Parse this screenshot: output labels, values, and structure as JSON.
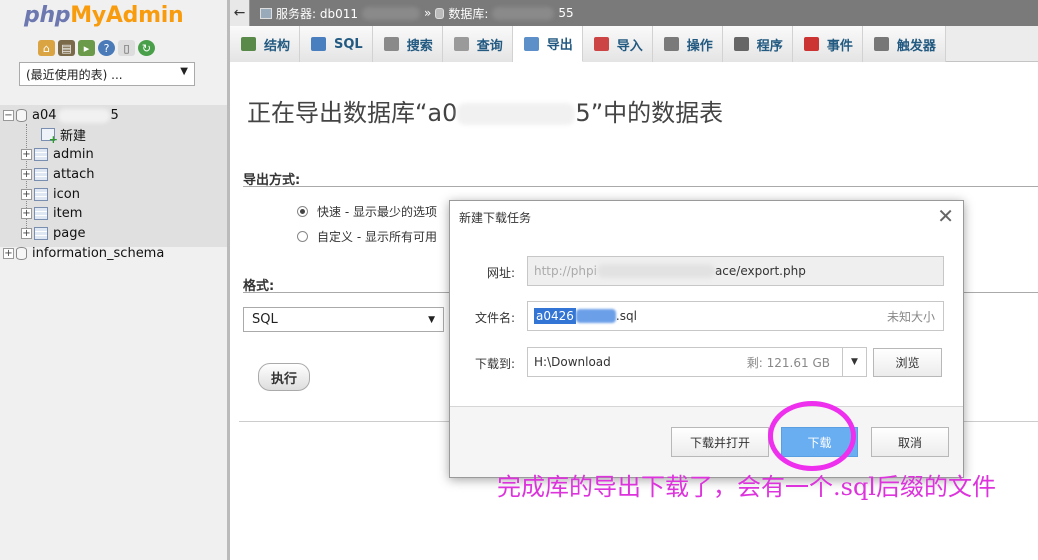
{
  "nav": {
    "logo": {
      "php": "php",
      "my": "My",
      "admin": "Admin"
    },
    "icons": [
      "home-icon",
      "database-icon",
      "sql-icon",
      "help-icon",
      "docs-icon",
      "settings-icon"
    ],
    "recent_tables": "(最近使用的表) ...",
    "tree": {
      "db_name_prefix": "a04",
      "db_name_suffix": "5",
      "new_label": "新建",
      "tables": [
        "admin",
        "attach",
        "icon",
        "item",
        "page"
      ],
      "other_db": "information_schema"
    }
  },
  "topbar": {
    "back": "←",
    "server_label": "服务器: db011",
    "separator": "»",
    "database_label": "数据库:",
    "database_suffix": "55"
  },
  "tabs": [
    {
      "label": "结构",
      "icon": "structure-icon",
      "color": "#5a8a4a"
    },
    {
      "label": "SQL",
      "icon": "sql-icon",
      "color": "#4a7fbf"
    },
    {
      "label": "搜索",
      "icon": "search-icon",
      "color": "#8a8a8a"
    },
    {
      "label": "查询",
      "icon": "query-icon",
      "color": "#9a9a9a"
    },
    {
      "label": "导出",
      "icon": "export-icon",
      "color": "#5d8fc8",
      "active": true
    },
    {
      "label": "导入",
      "icon": "import-icon",
      "color": "#c44"
    },
    {
      "label": "操作",
      "icon": "wrench-icon",
      "color": "#7a7a7a"
    },
    {
      "label": "程序",
      "icon": "routines-icon",
      "color": "#666"
    },
    {
      "label": "事件",
      "icon": "clock-icon",
      "color": "#c33"
    },
    {
      "label": "触发器",
      "icon": "trigger-icon",
      "color": "#777"
    }
  ],
  "main": {
    "title_prefix": "正在导出数据库“a0",
    "title_suffix": "5”中的数据表",
    "export_method_label": "导出方式:",
    "quick_option": "快速 - 显示最少的选项",
    "custom_option": "自定义 - 显示所有可用",
    "format_label": "格式:",
    "format_value": "SQL",
    "execute_button": "执行"
  },
  "dialog": {
    "title": "新建下载任务",
    "close": "✕",
    "url_label": "网址:",
    "url_start": "http://phpi",
    "url_end": "ace/export.php",
    "filename_label": "文件名:",
    "filename_selected": "a0426",
    "filename_ext": ".sql",
    "size_text": "未知大小",
    "save_to_label": "下载到:",
    "save_path": "H:\\Download",
    "free_space": "剩: 121.61 GB",
    "browse_button": "浏览",
    "download_open_button": "下载并打开",
    "download_button": "下载",
    "cancel_button": "取消"
  },
  "annotation": {
    "caption": "完成库的导出下载了，会有一个.sql后缀的文件",
    "color": "#dd33dd"
  }
}
